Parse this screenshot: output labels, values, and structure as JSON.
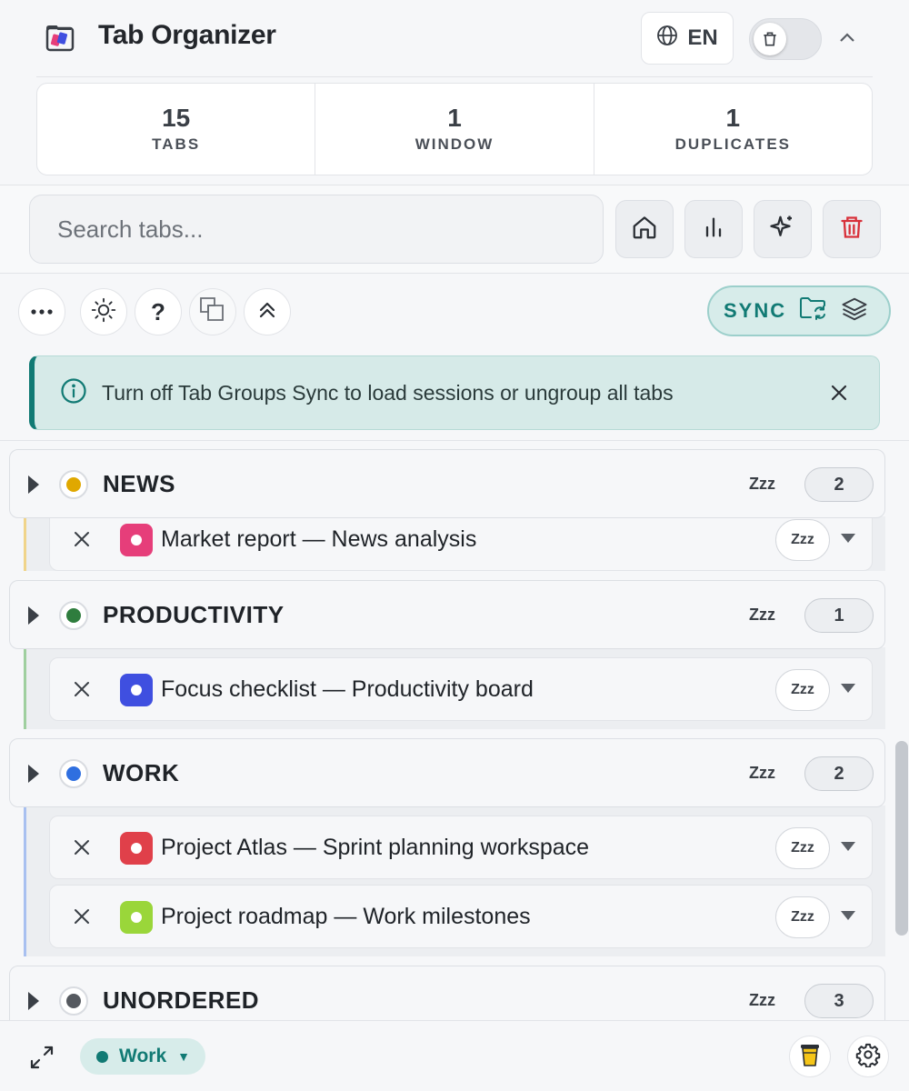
{
  "header": {
    "title": "Tab Organizer",
    "language": "EN",
    "logo_icon": "tab-organizer-logo",
    "toggle_icon": "trash-icon",
    "collapse_icon": "chevron-up-icon"
  },
  "stats": [
    {
      "value": "15",
      "label": "TABS"
    },
    {
      "value": "1",
      "label": "WINDOW"
    },
    {
      "value": "1",
      "label": "DUPLICATES"
    }
  ],
  "search": {
    "placeholder": "Search tabs..."
  },
  "action_buttons": [
    "home-icon",
    "stats-icon",
    "sparkle-icon",
    "trash-icon"
  ],
  "toolbar": {
    "buttons": [
      "more-icon",
      "theme-icon",
      "help-icon",
      "duplicate-icon",
      "collapse-all-icon"
    ],
    "help_label": "?",
    "sync_label": "SYNC"
  },
  "banner": {
    "text": "Turn off Tab Groups Sync to load sessions or ungroup all tabs"
  },
  "groups": [
    {
      "name": "NEWS",
      "color": "#e0a800",
      "zzz": "Zzz",
      "count": "2",
      "tabs": [
        {
          "title": "Market report — News analysis",
          "favicon_color": "#e63e7a",
          "zzz": "Zzz"
        }
      ]
    },
    {
      "name": "PRODUCTIVITY",
      "color": "#2f7d3e",
      "zzz": "Zzz",
      "count": "1",
      "tabs": [
        {
          "title": "Focus checklist — Productivity board",
          "favicon_color": "#3f4fe0",
          "zzz": "Zzz"
        }
      ]
    },
    {
      "name": "WORK",
      "color": "#2f6fe0",
      "zzz": "Zzz",
      "count": "2",
      "tabs": [
        {
          "title": "Project Atlas — Sprint planning workspace",
          "favicon_color": "#e0404a",
          "zzz": "Zzz"
        },
        {
          "title": "Project roadmap — Work milestones",
          "favicon_color": "#9ad63a",
          "zzz": "Zzz"
        }
      ]
    },
    {
      "name": "UNORDERED",
      "color": "#55595f",
      "zzz": "Zzz",
      "count": "3",
      "tabs": []
    }
  ],
  "footer": {
    "window_label": "Work",
    "window_arrow": "▼",
    "accent": "#117a74",
    "buttons": [
      "expand-icon",
      "coffee-icon",
      "settings-icon"
    ]
  }
}
